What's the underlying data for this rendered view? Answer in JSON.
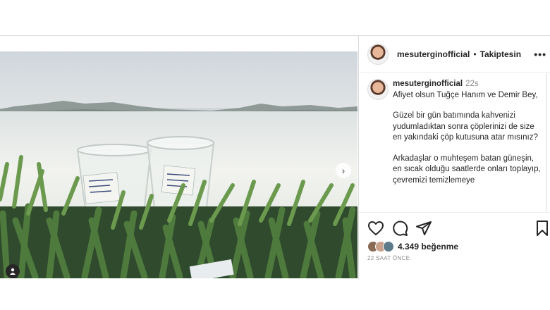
{
  "post": {
    "username": "mesuterginofficial",
    "separator": "•",
    "follow_status": "Takiptesin",
    "more_glyph": "•••",
    "next_glyph": "›"
  },
  "caption": {
    "username": "mesuterginofficial",
    "time": "22s",
    "paragraphs": [
      "Afiyet olsun Tuğçe Hanım ve Demir Bey,",
      "Güzel bir gün batımında kahvenizi yudumladıktan sonra çöplerinizi de size en yakındaki çöp kutusuna atar mısınız?",
      "Arkadaşlar o muhteşem batan güneşin, en sıcak olduğu saatlerde onları toplayıp, çevremizi temizlemeye"
    ]
  },
  "engagement": {
    "likes": "4.349 beğenme",
    "posted_ago": "22 SAAT ÖNCE"
  },
  "icons": {
    "like": "heart-icon",
    "comment": "comment-icon",
    "share": "share-icon",
    "save": "bookmark-icon",
    "tag": "user-tag-icon"
  }
}
